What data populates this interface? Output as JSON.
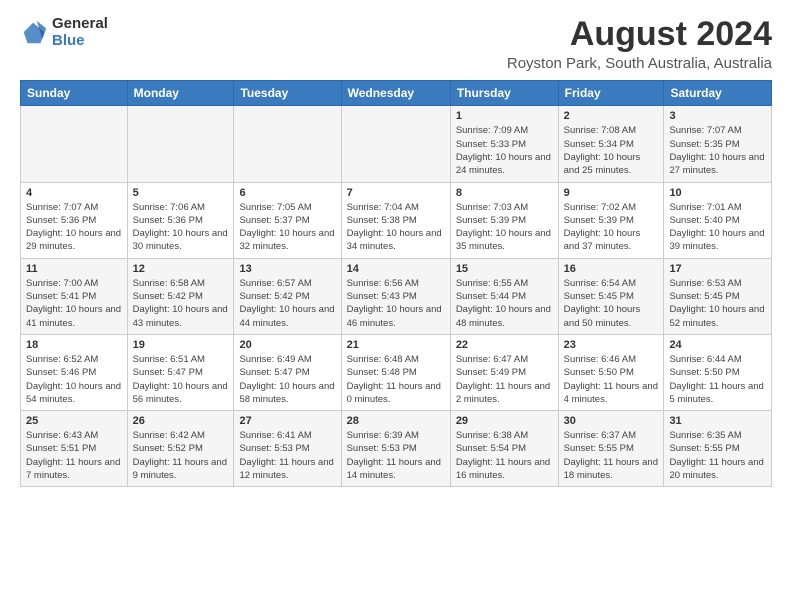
{
  "logo": {
    "general": "General",
    "blue": "Blue"
  },
  "title": "August 2024",
  "subtitle": "Royston Park, South Australia, Australia",
  "days_header": [
    "Sunday",
    "Monday",
    "Tuesday",
    "Wednesday",
    "Thursday",
    "Friday",
    "Saturday"
  ],
  "weeks": [
    [
      {
        "day": "",
        "info": ""
      },
      {
        "day": "",
        "info": ""
      },
      {
        "day": "",
        "info": ""
      },
      {
        "day": "",
        "info": ""
      },
      {
        "day": "1",
        "info": "Sunrise: 7:09 AM\nSunset: 5:33 PM\nDaylight: 10 hours\nand 24 minutes."
      },
      {
        "day": "2",
        "info": "Sunrise: 7:08 AM\nSunset: 5:34 PM\nDaylight: 10 hours\nand 25 minutes."
      },
      {
        "day": "3",
        "info": "Sunrise: 7:07 AM\nSunset: 5:35 PM\nDaylight: 10 hours\nand 27 minutes."
      }
    ],
    [
      {
        "day": "4",
        "info": "Sunrise: 7:07 AM\nSunset: 5:36 PM\nDaylight: 10 hours\nand 29 minutes."
      },
      {
        "day": "5",
        "info": "Sunrise: 7:06 AM\nSunset: 5:36 PM\nDaylight: 10 hours\nand 30 minutes."
      },
      {
        "day": "6",
        "info": "Sunrise: 7:05 AM\nSunset: 5:37 PM\nDaylight: 10 hours\nand 32 minutes."
      },
      {
        "day": "7",
        "info": "Sunrise: 7:04 AM\nSunset: 5:38 PM\nDaylight: 10 hours\nand 34 minutes."
      },
      {
        "day": "8",
        "info": "Sunrise: 7:03 AM\nSunset: 5:39 PM\nDaylight: 10 hours\nand 35 minutes."
      },
      {
        "day": "9",
        "info": "Sunrise: 7:02 AM\nSunset: 5:39 PM\nDaylight: 10 hours\nand 37 minutes."
      },
      {
        "day": "10",
        "info": "Sunrise: 7:01 AM\nSunset: 5:40 PM\nDaylight: 10 hours\nand 39 minutes."
      }
    ],
    [
      {
        "day": "11",
        "info": "Sunrise: 7:00 AM\nSunset: 5:41 PM\nDaylight: 10 hours\nand 41 minutes."
      },
      {
        "day": "12",
        "info": "Sunrise: 6:58 AM\nSunset: 5:42 PM\nDaylight: 10 hours\nand 43 minutes."
      },
      {
        "day": "13",
        "info": "Sunrise: 6:57 AM\nSunset: 5:42 PM\nDaylight: 10 hours\nand 44 minutes."
      },
      {
        "day": "14",
        "info": "Sunrise: 6:56 AM\nSunset: 5:43 PM\nDaylight: 10 hours\nand 46 minutes."
      },
      {
        "day": "15",
        "info": "Sunrise: 6:55 AM\nSunset: 5:44 PM\nDaylight: 10 hours\nand 48 minutes."
      },
      {
        "day": "16",
        "info": "Sunrise: 6:54 AM\nSunset: 5:45 PM\nDaylight: 10 hours\nand 50 minutes."
      },
      {
        "day": "17",
        "info": "Sunrise: 6:53 AM\nSunset: 5:45 PM\nDaylight: 10 hours\nand 52 minutes."
      }
    ],
    [
      {
        "day": "18",
        "info": "Sunrise: 6:52 AM\nSunset: 5:46 PM\nDaylight: 10 hours\nand 54 minutes."
      },
      {
        "day": "19",
        "info": "Sunrise: 6:51 AM\nSunset: 5:47 PM\nDaylight: 10 hours\nand 56 minutes."
      },
      {
        "day": "20",
        "info": "Sunrise: 6:49 AM\nSunset: 5:47 PM\nDaylight: 10 hours\nand 58 minutes."
      },
      {
        "day": "21",
        "info": "Sunrise: 6:48 AM\nSunset: 5:48 PM\nDaylight: 11 hours\nand 0 minutes."
      },
      {
        "day": "22",
        "info": "Sunrise: 6:47 AM\nSunset: 5:49 PM\nDaylight: 11 hours\nand 2 minutes."
      },
      {
        "day": "23",
        "info": "Sunrise: 6:46 AM\nSunset: 5:50 PM\nDaylight: 11 hours\nand 4 minutes."
      },
      {
        "day": "24",
        "info": "Sunrise: 6:44 AM\nSunset: 5:50 PM\nDaylight: 11 hours\nand 5 minutes."
      }
    ],
    [
      {
        "day": "25",
        "info": "Sunrise: 6:43 AM\nSunset: 5:51 PM\nDaylight: 11 hours\nand 7 minutes."
      },
      {
        "day": "26",
        "info": "Sunrise: 6:42 AM\nSunset: 5:52 PM\nDaylight: 11 hours\nand 9 minutes."
      },
      {
        "day": "27",
        "info": "Sunrise: 6:41 AM\nSunset: 5:53 PM\nDaylight: 11 hours\nand 12 minutes."
      },
      {
        "day": "28",
        "info": "Sunrise: 6:39 AM\nSunset: 5:53 PM\nDaylight: 11 hours\nand 14 minutes."
      },
      {
        "day": "29",
        "info": "Sunrise: 6:38 AM\nSunset: 5:54 PM\nDaylight: 11 hours\nand 16 minutes."
      },
      {
        "day": "30",
        "info": "Sunrise: 6:37 AM\nSunset: 5:55 PM\nDaylight: 11 hours\nand 18 minutes."
      },
      {
        "day": "31",
        "info": "Sunrise: 6:35 AM\nSunset: 5:55 PM\nDaylight: 11 hours\nand 20 minutes."
      }
    ]
  ]
}
